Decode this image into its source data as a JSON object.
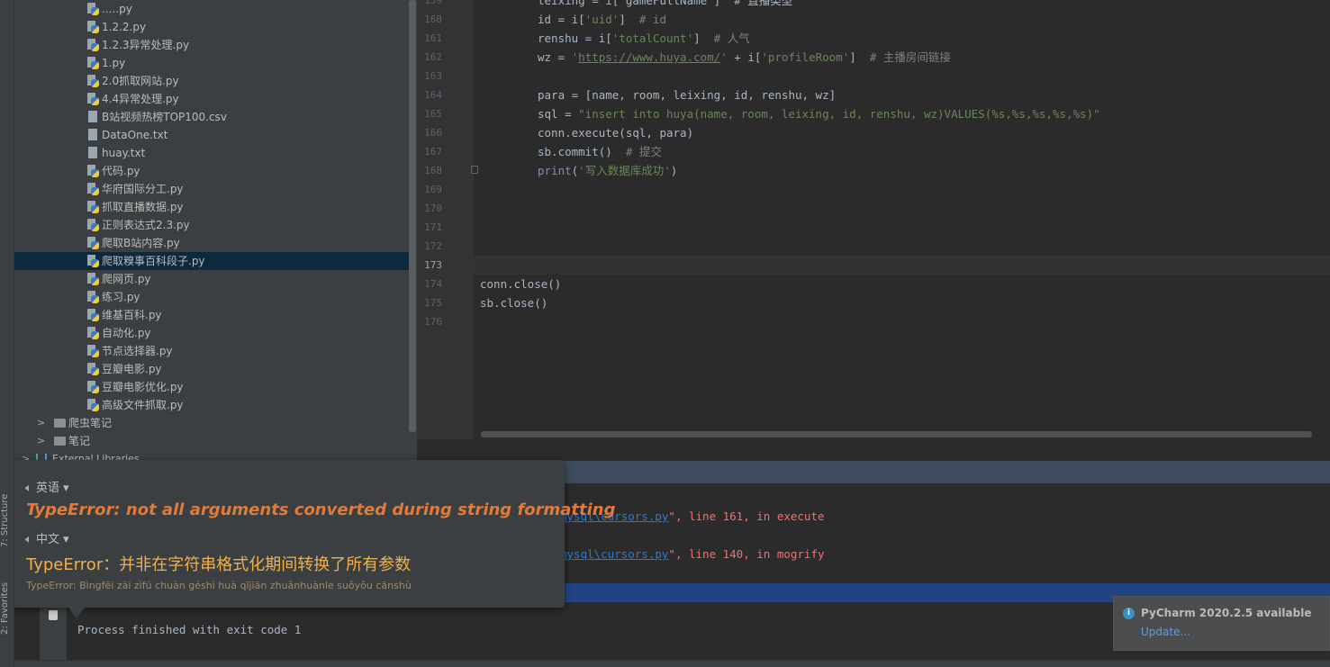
{
  "sidebar_strip": {
    "structure": "7: Structure",
    "favorites": "2: Favorites"
  },
  "project_tree": {
    "files": [
      {
        "name": ".....py",
        "type": "py"
      },
      {
        "name": "1.2.2.py",
        "type": "py"
      },
      {
        "name": "1.2.3异常处理.py",
        "type": "py"
      },
      {
        "name": "1.py",
        "type": "py"
      },
      {
        "name": "2.0抓取网站.py",
        "type": "py"
      },
      {
        "name": "4.4异常处理.py",
        "type": "py"
      },
      {
        "name": "B站视频热榜TOP100.csv",
        "type": "text"
      },
      {
        "name": "DataOne.txt",
        "type": "text"
      },
      {
        "name": "huay.txt",
        "type": "text"
      },
      {
        "name": "代码.py",
        "type": "py"
      },
      {
        "name": "华府国际分工.py",
        "type": "py"
      },
      {
        "name": "抓取直播数据.py",
        "type": "py"
      },
      {
        "name": "正则表达式2.3.py",
        "type": "py"
      },
      {
        "name": "爬取B站内容.py",
        "type": "py"
      },
      {
        "name": "爬取糗事百科段子.py",
        "type": "py",
        "selected": true
      },
      {
        "name": "爬网页.py",
        "type": "py"
      },
      {
        "name": "练习.py",
        "type": "py"
      },
      {
        "name": "维基百科.py",
        "type": "py"
      },
      {
        "name": "自动化.py",
        "type": "py"
      },
      {
        "name": "节点选择器.py",
        "type": "py"
      },
      {
        "name": "豆瓣电影.py",
        "type": "py"
      },
      {
        "name": "豆瓣电影优化.py",
        "type": "py"
      },
      {
        "name": "高级文件抓取.py",
        "type": "py"
      }
    ],
    "folders": [
      "爬虫笔记",
      "笔记"
    ],
    "external": "External Libraries"
  },
  "editor": {
    "line_numbers": [
      "159",
      "160",
      "161",
      "162",
      "163",
      "164",
      "165",
      "166",
      "167",
      "168",
      "169",
      "170",
      "171",
      "172",
      "173",
      "174",
      "175",
      "176"
    ],
    "current_line": "173",
    "code": {
      "l159": "leixing = i['gameFullName']  # 直播类型",
      "l160a": "id = i[",
      "l160s": "'uid'",
      "l160b": "]  ",
      "l160c": "# id",
      "l161a": "renshu = i[",
      "l161s": "'totalCount'",
      "l161b": "]  ",
      "l161c": "# 人气",
      "l162a": "wz = ",
      "l162q": "'",
      "l162u": "https://www.huya.com/",
      "l162q2": "'",
      "l162b": " + i[",
      "l162s": "'profileRoom'",
      "l162e": "]  ",
      "l162c": "# 主播房间链接",
      "l164": "para = [name, room, leixing, id, renshu, wz]",
      "l165a": "sql = ",
      "l165s": "\"insert into huya(name, room, leixing, id, renshu, wz)VALUES(%s,%s,%s,%s,%s)\"",
      "l166": "conn.execute(sql, para)",
      "l167a": "sb.commit()  ",
      "l167c": "# 提交",
      "l168a": "print",
      "l168b": "(",
      "l168s": "'写入数据库成功'",
      "l168c": ")",
      "l174": "conn.close()",
      "l175": "sb.close()"
    }
  },
  "run_output": {
    "line1_link": "mysql\\cursors.py",
    "line1_rest": "\", line 161, in execute",
    "line2_link": "mysql\\cursors.py",
    "line2_rest": "\", line 140, in mogrify",
    "finished": "Process finished with exit code 1"
  },
  "translate_popup": {
    "source_lang": "英语",
    "source_text": "TypeError: not all arguments converted during string formatting",
    "target_lang": "中文",
    "target_text": "TypeError：并非在字符串格式化期间转换了所有参数",
    "pinyin": "TypeError: Bìngfēi zài zìfú chuàn géshì huà qījiān zhuǎnhuànle suǒyǒu cānshù"
  },
  "notification": {
    "title": "PyCharm 2020.2.5 available",
    "action": "Update..."
  },
  "colors": {
    "accent_orange": "#e07b39",
    "link": "#589df6",
    "selection": "#214283",
    "error": "#ff6b68"
  }
}
